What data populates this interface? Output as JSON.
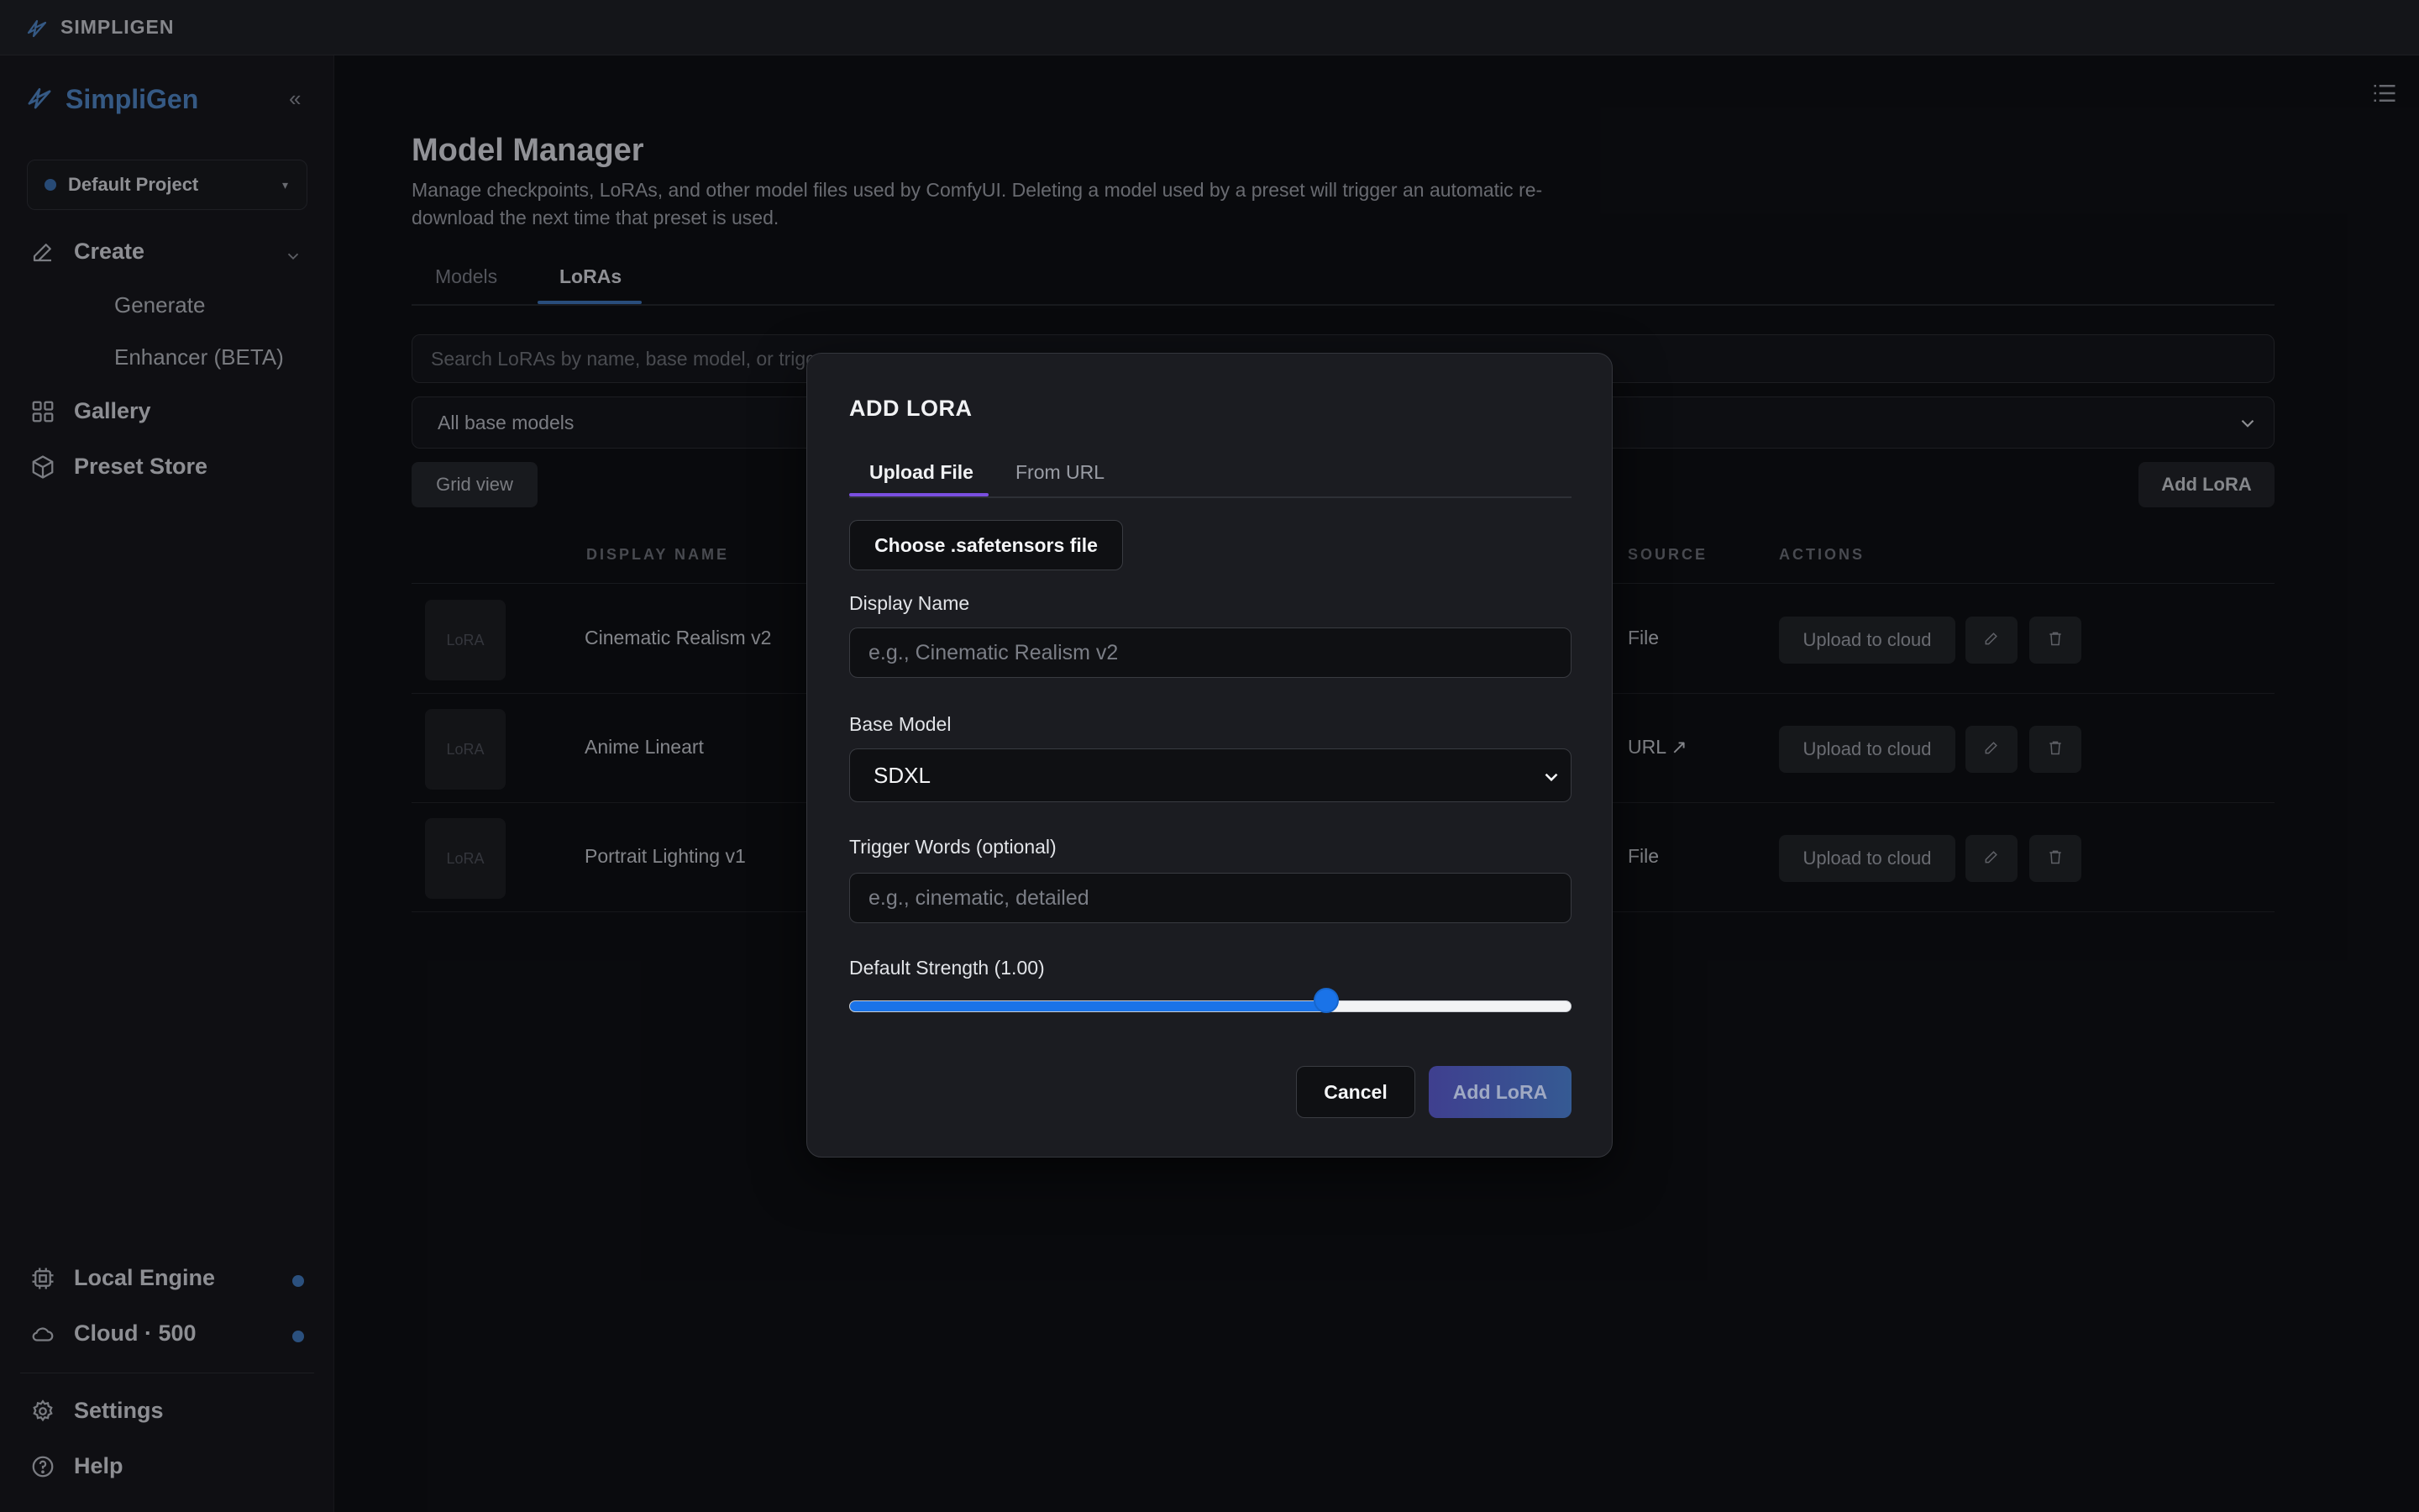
{
  "window": {
    "app_name": "SIMPLIGEN"
  },
  "sidebar": {
    "brand": "SimpliGen",
    "collapse_glyph": "«",
    "project": {
      "label": "Default Project",
      "caret": "▾"
    },
    "nav": {
      "create": "Create",
      "generate": "Generate",
      "enhancer": "Enhancer (BETA)",
      "gallery": "Gallery",
      "preset_store": "Preset Store",
      "local_engine": "Local Engine",
      "cloud": "Cloud · 500",
      "settings": "Settings",
      "help": "Help"
    },
    "icons": [
      "pencil-icon",
      "grid-icon",
      "cube-icon",
      "chip-icon",
      "cloud-icon",
      "gear-icon",
      "help-circle-icon"
    ]
  },
  "main": {
    "title": "Model Manager",
    "description": "Manage checkpoints, LoRAs, and other model files used by ComfyUI. Deleting a model used by a preset will trigger an automatic re-download the next time that preset is used.",
    "tabs": {
      "models": "Models",
      "loras": "LoRAs"
    },
    "search_placeholder": "Search LoRAs by name, base model, or trigg",
    "base_filter": "All base models",
    "grid_view": "Grid view",
    "add_lora": "Add LoRA",
    "columns": {
      "display_name": "DISPLAY NAME",
      "source": "SOURCE",
      "actions": "ACTIONS"
    },
    "rows": [
      {
        "thumb": "LoRA",
        "name": "Cinematic Realism v2",
        "source": "File",
        "upload": "Upload to cloud"
      },
      {
        "thumb": "LoRA",
        "name": "Anime Lineart",
        "source": "URL ↗",
        "upload": "Upload to cloud"
      },
      {
        "thumb": "LoRA",
        "name": "Portrait Lighting v1",
        "source": "File",
        "upload": "Upload to cloud"
      }
    ]
  },
  "modal": {
    "title": "ADD LORA",
    "tabs": {
      "upload": "Upload File",
      "url": "From URL"
    },
    "choose_file": "Choose .safetensors file",
    "display_name_label": "Display Name",
    "display_name_placeholder": "e.g., Cinematic Realism v2",
    "base_model_label": "Base Model",
    "base_model_value": "SDXL",
    "trigger_label": "Trigger Words (optional)",
    "trigger_placeholder": "e.g., cinematic, detailed",
    "strength_label": "Default Strength (1.00)",
    "strength_fraction": 0.66,
    "cancel": "Cancel",
    "submit": "Add LoRA"
  },
  "colors": {
    "accent": "#3d73b8",
    "brand": "#4f86c6",
    "modal_tab_accent": "#7a4fe0",
    "slider": "#1a73e8"
  }
}
